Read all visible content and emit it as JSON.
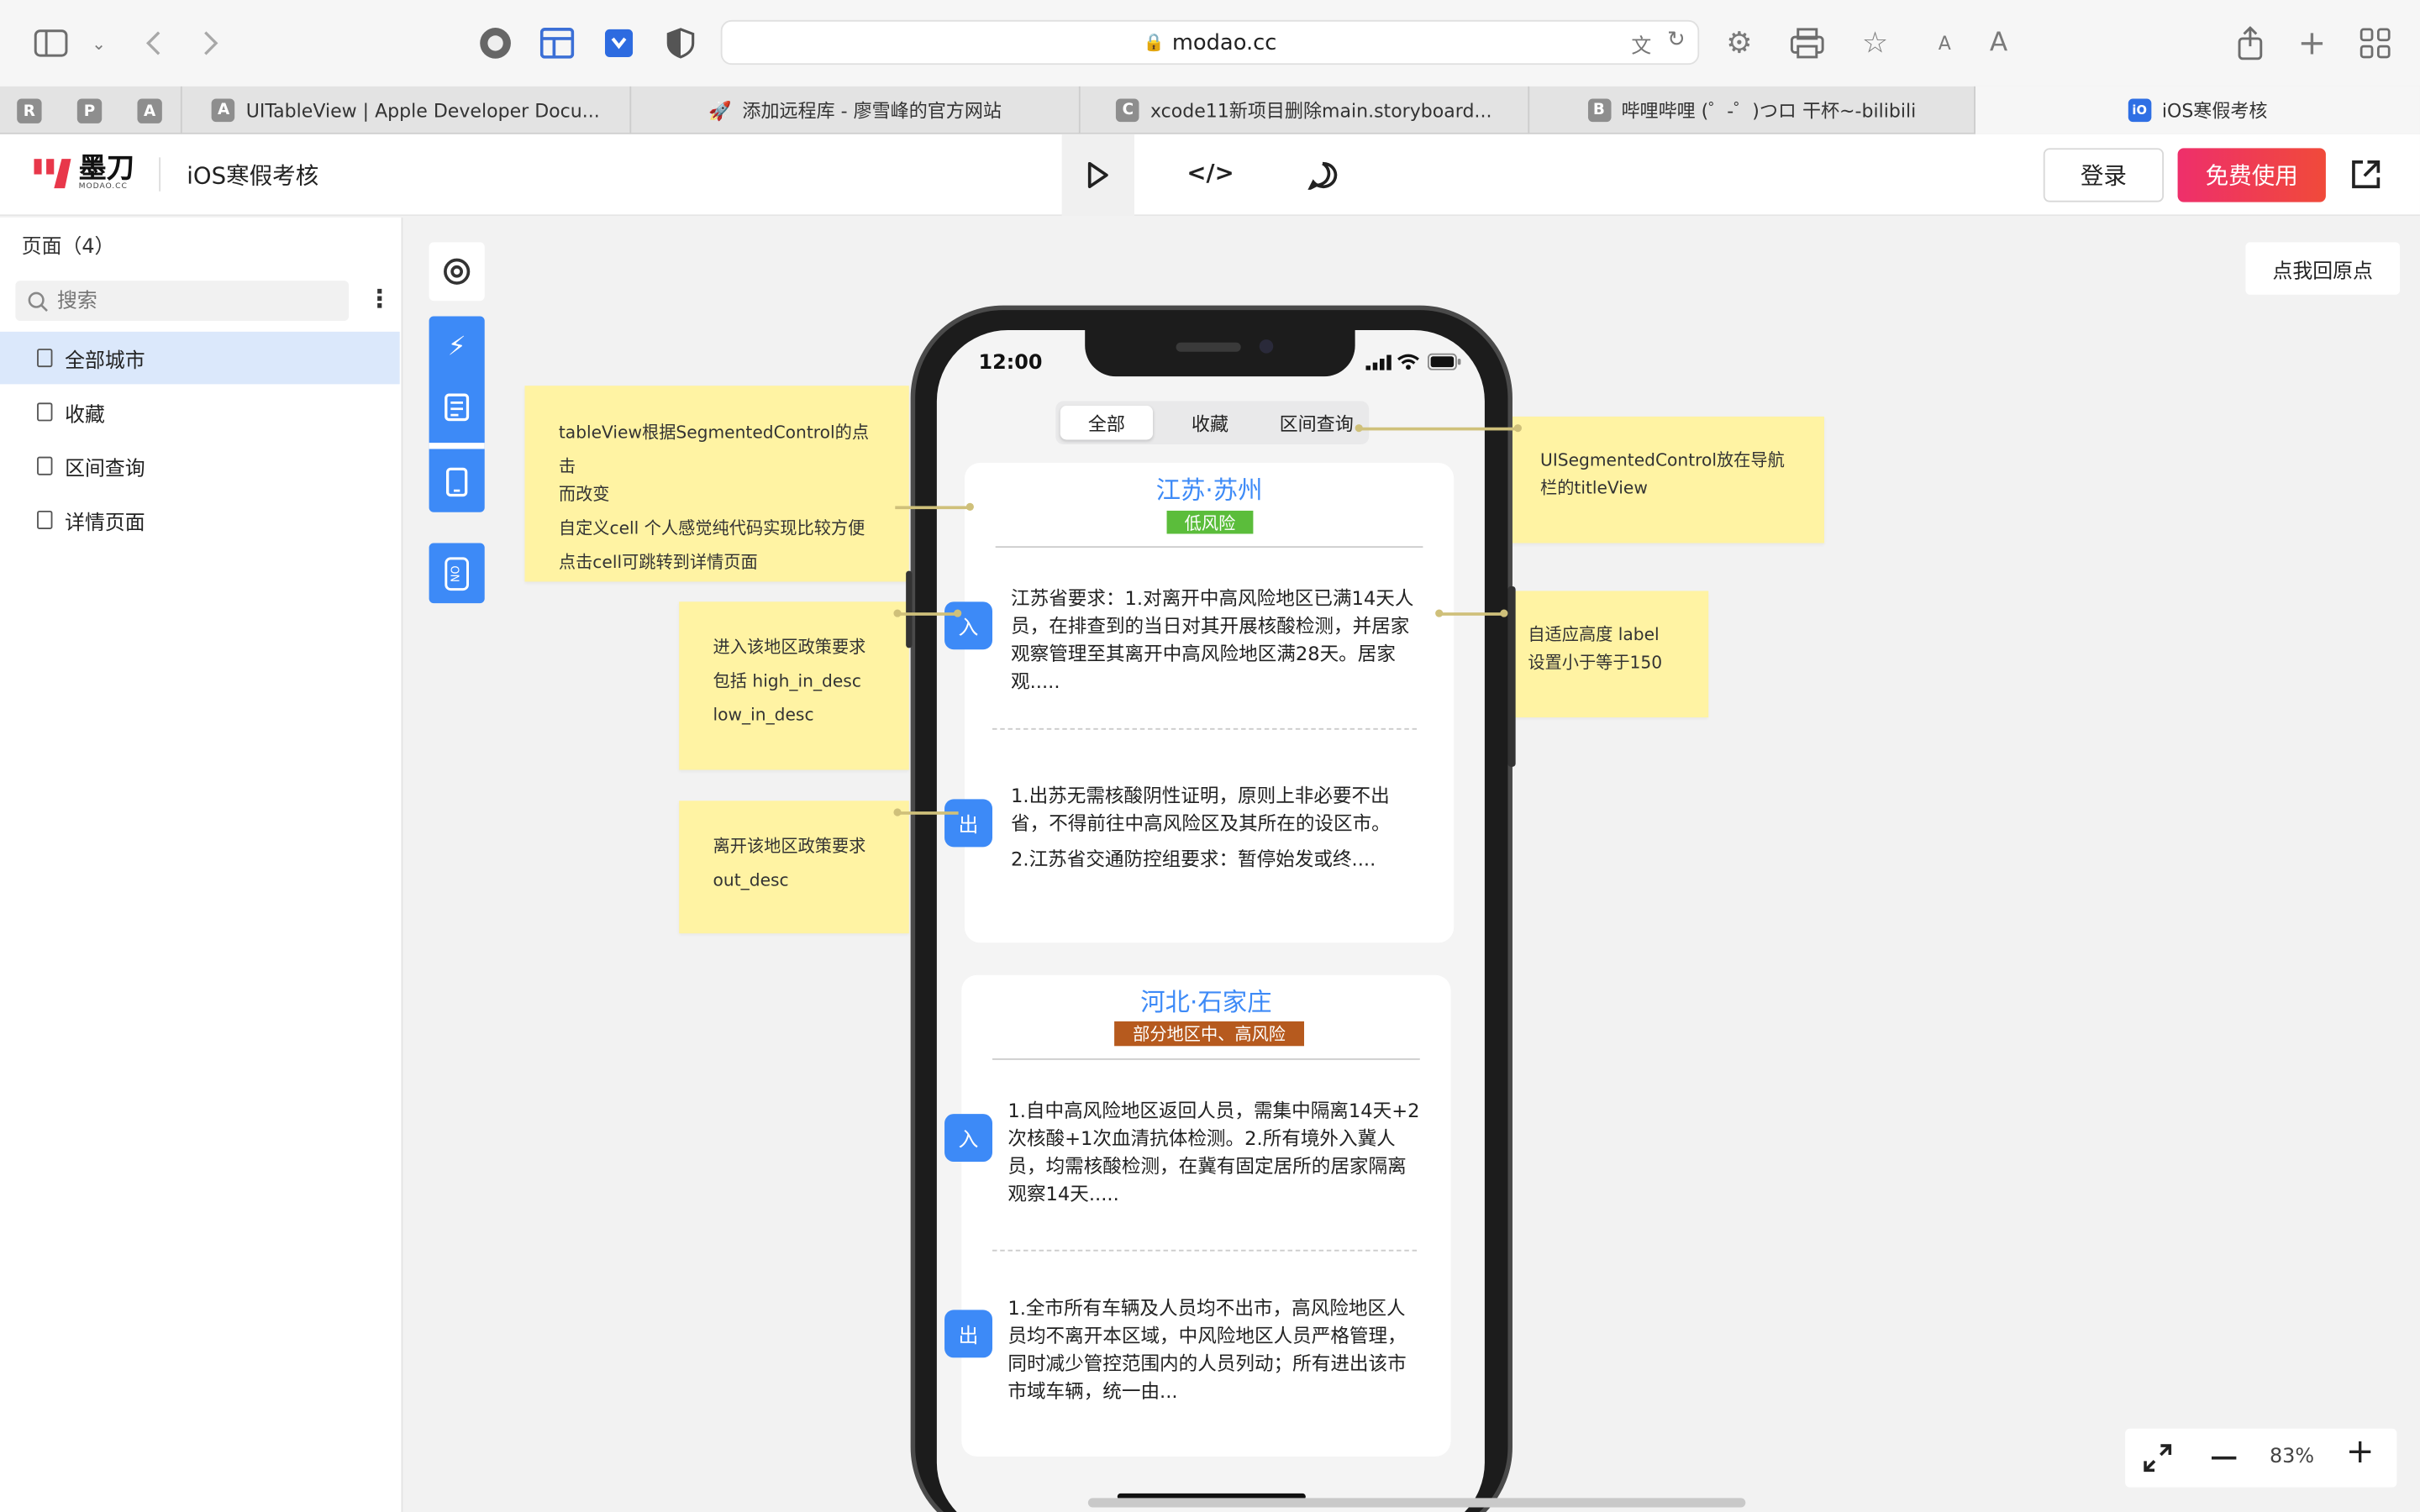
{
  "browser": {
    "url": "modao.cc",
    "icons": [
      "sidebar-icon",
      "chevron-down-icon",
      "back-icon",
      "forward-icon",
      "extension-icon",
      "grid-icon",
      "bookmark-icon",
      "shield-icon",
      "lock-icon",
      "translate-icon",
      "reload-icon",
      "gear-icon",
      "printer-icon",
      "star-icon",
      "font-smaller-icon",
      "font-larger-icon",
      "share-icon",
      "plus-icon",
      "tab-overview-icon"
    ],
    "font_small": "A",
    "font_large": "A",
    "pinned_tabs": [
      "R",
      "P",
      "A"
    ],
    "tabs": [
      {
        "fav": "A",
        "title": "UITableView | Apple Developer Docu..."
      },
      {
        "fav": "🚀",
        "title": "添加远程库 - 廖雪峰的官方网站"
      },
      {
        "fav": "C",
        "title": "xcode11新项目删除main.storyboard..."
      },
      {
        "fav": "B",
        "title": "哔哩哔哩 (゜-゜)つロ 干杯~-bilibili"
      },
      {
        "fav": "iO",
        "title": "iOS寒假考核"
      }
    ]
  },
  "app": {
    "logo_text": "墨刀",
    "logo_sub": "MODAO.CC",
    "project_title": "iOS寒假考核",
    "login_label": "登录",
    "free_label": "免费使用",
    "accent": "#e8374a"
  },
  "sidebar": {
    "heading": "页面（4）",
    "search_placeholder": "搜索",
    "pages": [
      "全部城市",
      "收藏",
      "区间查询",
      "详情页面"
    ]
  },
  "canvas": {
    "origin_button": "点我回原点",
    "zoom": "83%",
    "notes": {
      "n1": [
        "tableView根据SegmentedControl的点击",
        "而改变",
        "自定义cell  个人感觉纯代码实现比较方便",
        "点击cell可跳转到详情页面"
      ],
      "n2": [
        "UISegmentedControl放在导航",
        "栏的titleView"
      ],
      "n3": [
        "进入该地区政策要求",
        "包括 high_in_desc",
        "low_in_desc"
      ],
      "n4": [
        "自适应高度   label",
        "设置小于等于150"
      ],
      "n5": [
        "离开该地区政策要求",
        "out_desc"
      ]
    }
  },
  "phone": {
    "time": "12:00",
    "segments": [
      "全部",
      "收藏",
      "区间查询"
    ],
    "in_label": "入",
    "out_label": "出",
    "cards": [
      {
        "city": "江苏·苏州",
        "risk": "低风险",
        "risk_color": "#5bbd3b",
        "in_lines": [
          "江苏省要求：1.对离开中高风险地区已满14天人",
          "员，在排查到的当日对其开展核酸检测，并居家",
          "观察管理至其离开中高风险地区满28天。居家",
          "观....."
        ],
        "out_lines": [
          "1.出苏无需核酸阴性证明，原则上非必要不出",
          "省，不得前往中高风险区及其所在的设区市。",
          "2.江苏省交通防控组要求：暂停始发或终...."
        ]
      },
      {
        "city": "河北·石家庄",
        "risk": "部分地区中、高风险",
        "risk_color": "#b65a1e",
        "in_lines": [
          "1.自中高风险地区返回人员，需集中隔离14天+2",
          "次核酸+1次血清抗体检测。2.所有境外入冀人",
          "员，均需核酸检测，在冀有固定居所的居家隔离",
          "观察14天....."
        ],
        "out_lines": [
          "1.全市所有车辆及人员均不出市，高风险地区人",
          "员均不离开本区域，中风险地区人员严格管理，",
          "同时减少管控范围内的人员列动；所有进出该市",
          "市域车辆，统一由..."
        ]
      }
    ]
  }
}
